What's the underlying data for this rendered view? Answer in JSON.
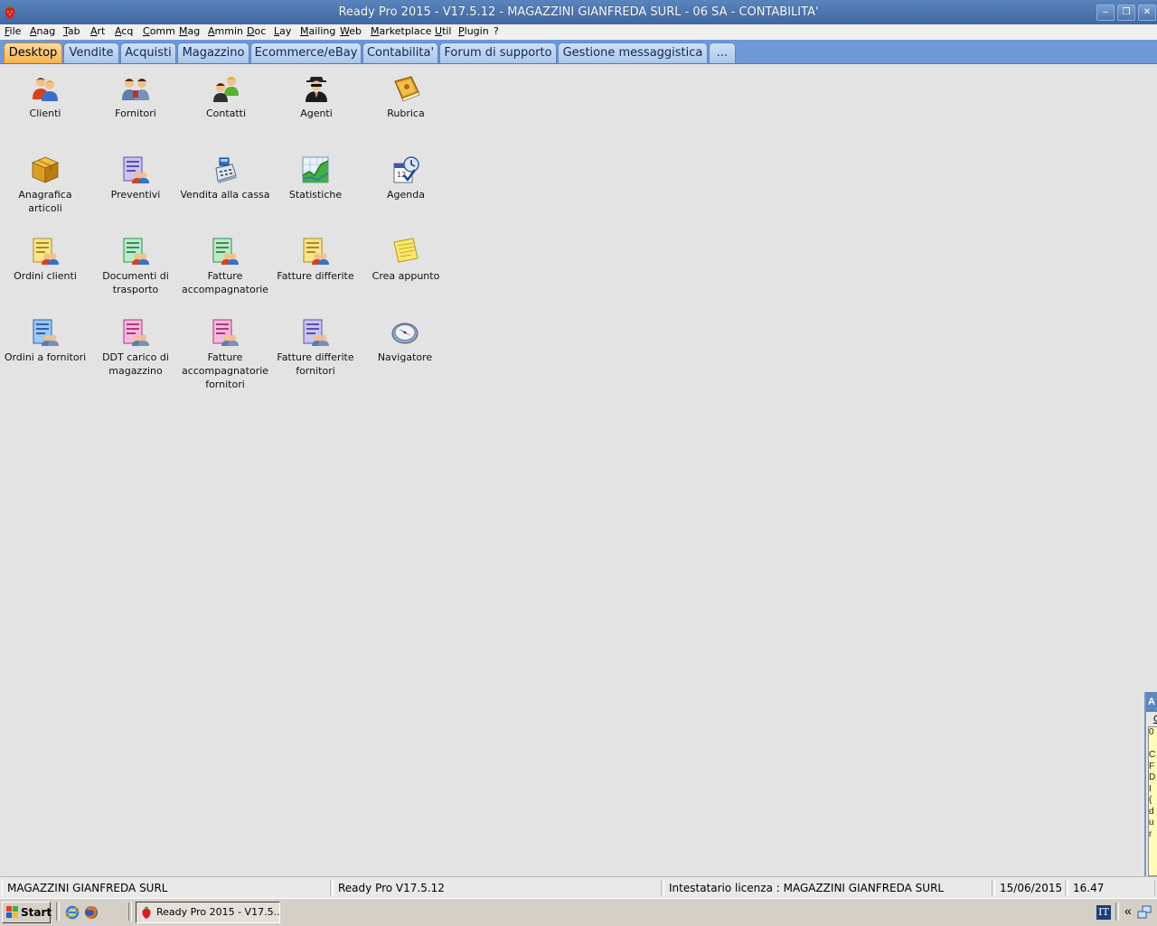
{
  "window": {
    "title": "Ready Pro 2015 - V17.5.12 - MAGAZZINI GIANFREDA SURL - 06 SA - CONTABILITA'",
    "minimize": "–",
    "restore": "❐",
    "close": "✕"
  },
  "menu": [
    "File",
    "Anag",
    "Tab",
    "Art",
    "Acq",
    "Comm",
    "Mag",
    "Ammin",
    "Doc",
    "Lay",
    "Mailing",
    "Web",
    "Marketplace",
    "Util",
    "Plugin",
    "?"
  ],
  "tabs": [
    "Desktop",
    "Vendite",
    "Acquisti",
    "Magazzino",
    "Ecommerce/eBay",
    "Contabilita'",
    "Forum di supporto",
    "Gestione messaggistica",
    "..."
  ],
  "active_tab": "Desktop",
  "icons": [
    {
      "label": "Clienti",
      "icon": "customers-icon"
    },
    {
      "label": "Fornitori",
      "icon": "suppliers-icon"
    },
    {
      "label": "Contatti",
      "icon": "contacts-icon"
    },
    {
      "label": "Agenti",
      "icon": "agent-icon"
    },
    {
      "label": "Rubrica",
      "icon": "address-book-icon"
    },
    {
      "label": "Anagrafica articoli",
      "icon": "box-icon"
    },
    {
      "label": "Preventivi",
      "icon": "quote-document-icon"
    },
    {
      "label": "Vendita alla cassa",
      "icon": "cash-register-icon"
    },
    {
      "label": "Statistiche",
      "icon": "chart-icon"
    },
    {
      "label": "Agenda",
      "icon": "calendar-clock-icon"
    },
    {
      "label": "Ordini clienti",
      "icon": "customer-order-icon"
    },
    {
      "label": "Documenti di trasporto",
      "icon": "transport-doc-icon"
    },
    {
      "label": "Fatture accompagnatorie",
      "icon": "accompanying-invoice-icon"
    },
    {
      "label": "Fatture differite",
      "icon": "deferred-invoice-icon"
    },
    {
      "label": "Crea appunto",
      "icon": "note-icon"
    },
    {
      "label": "Ordini a fornitori",
      "icon": "supplier-order-icon"
    },
    {
      "label": "DDT carico di magazzino",
      "icon": "warehouse-ddt-icon"
    },
    {
      "label": "Fatture accompagnatorie fornitori",
      "icon": "supplier-accompanying-invoice-icon"
    },
    {
      "label": "Fatture differite fornitori",
      "icon": "supplier-deferred-invoice-icon"
    },
    {
      "label": "Navigatore",
      "icon": "compass-icon"
    }
  ],
  "side_panel": {
    "header": "A",
    "tab": "G",
    "lines": "0\n\nC\nF\nD\nI\n(\nd\nu\nr"
  },
  "status": {
    "company": "MAGAZZINI GIANFREDA SURL",
    "version": "Ready Pro V17.5.12",
    "license": "Intestatario licenza : MAGAZZINI GIANFREDA SURL",
    "date": "15/06/2015",
    "time": "16.47"
  },
  "taskbar": {
    "start": "Start",
    "task": "Ready Pro 2015 - V17.5....",
    "language": "IT",
    "chevron": "«"
  },
  "colors": {
    "titlebar": "#4a74ad",
    "tabbar": "#6d9ad6",
    "active_tab": "#f6b453",
    "desktop": "#e3e3e3"
  }
}
